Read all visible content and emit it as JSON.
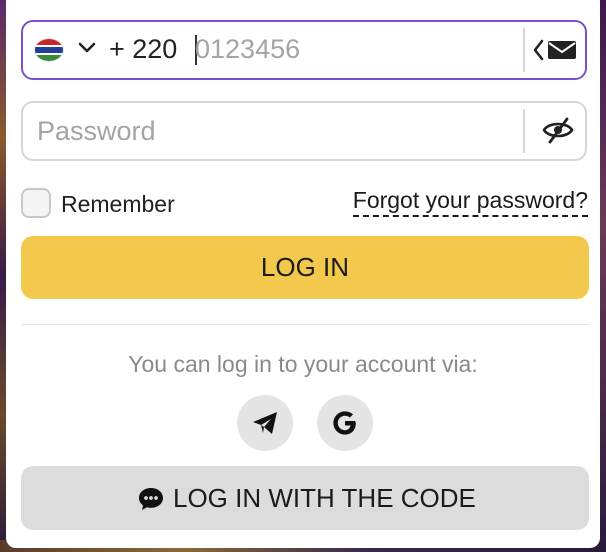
{
  "phone": {
    "dial_code": "+ 220",
    "placeholder": "0123456",
    "value": "",
    "country_flag": "flag-gambia-icon"
  },
  "password": {
    "placeholder": "Password",
    "value": ""
  },
  "remember": {
    "label": "Remember",
    "checked": false
  },
  "forgot_link": "Forgot your password?",
  "login_button": "LOG IN",
  "social": {
    "prompt": "You can log in to your account via:",
    "providers": [
      "telegram-icon",
      "google-icon"
    ]
  },
  "code_button": "LOG IN WITH THE CODE",
  "colors": {
    "accent_focus": "#7b4fc9",
    "login_button": "#f2c94c",
    "code_button": "#dcdcdc",
    "social_bg": "#e4e4e4"
  }
}
